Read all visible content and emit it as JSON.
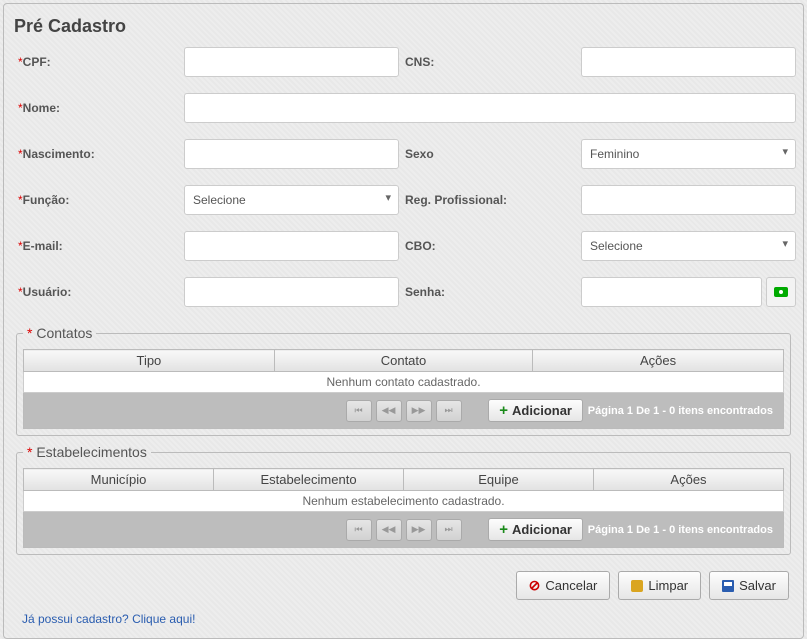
{
  "title": "Pré Cadastro",
  "labels": {
    "cpf": "CPF:",
    "cns": "CNS:",
    "nome": "Nome:",
    "nascimento": "Nascimento:",
    "sexo": "Sexo",
    "funcao": "Função:",
    "regprof": "Reg. Profissional:",
    "email": "E-mail:",
    "cbo": "CBO:",
    "usuario": "Usuário:",
    "senha": "Senha:"
  },
  "values": {
    "cpf": "",
    "cns": "",
    "nome": "",
    "nascimento": "",
    "sexo": "Feminino",
    "funcao": "Selecione",
    "regprof": "",
    "email": "",
    "cbo": "Selecione",
    "usuario": "",
    "senha": ""
  },
  "contatos": {
    "legend": "Contatos",
    "headers": {
      "tipo": "Tipo",
      "contato": "Contato",
      "acoes": "Ações"
    },
    "empty": "Nenhum contato cadastrado.",
    "add": "Adicionar",
    "pageinfo": "Página 1 De 1 - 0 itens encontrados"
  },
  "estab": {
    "legend": "Estabelecimentos",
    "headers": {
      "mun": "Município",
      "est": "Estabelecimento",
      "eq": "Equipe",
      "acoes": "Ações"
    },
    "empty": "Nenhum estabelecimento cadastrado.",
    "add": "Adicionar",
    "pageinfo": "Página 1 De 1 - 0 itens encontrados"
  },
  "buttons": {
    "cancel": "Cancelar",
    "limpar": "Limpar",
    "salvar": "Salvar"
  },
  "footer_link": "Já possui cadastro? Clique aqui!"
}
